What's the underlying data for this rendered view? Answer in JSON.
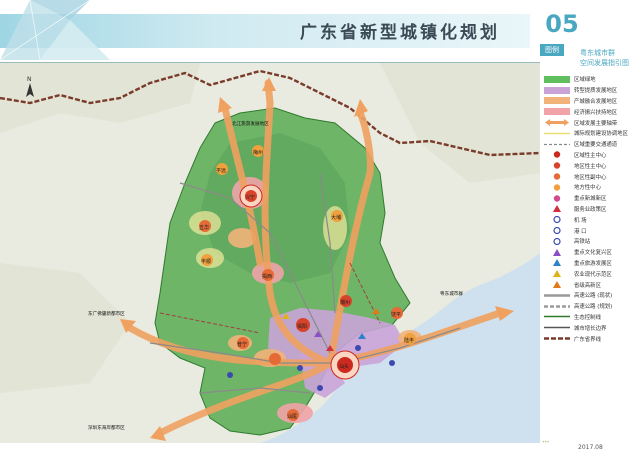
{
  "header": {
    "title": "广东省新型城镇化规划",
    "chapter": "05"
  },
  "side": {
    "legend_tag": "图例",
    "title_line1": "粤东城市群",
    "title_line2": "空间发展指引图",
    "date": "2017.08",
    "logo": "ᐩᐩᐩ"
  },
  "legend": [
    {
      "label": "区域绿地",
      "swatch": "fill",
      "color": "#5fbf5f"
    },
    {
      "label": "转型提质发展地区",
      "swatch": "fill",
      "color": "#c9a3d8"
    },
    {
      "label": "产城融合发展地区",
      "swatch": "fill",
      "color": "#f2b37a"
    },
    {
      "label": "经济振兴扶持地区",
      "swatch": "fill",
      "color": "#f1a3a8"
    },
    {
      "label": "区域发展主要轴带",
      "swatch": "arrow",
      "color": "#f0a160"
    },
    {
      "label": "城际规划建设协调地区",
      "swatch": "line",
      "color": "#e8e070"
    },
    {
      "label": "区域重要交通通道",
      "swatch": "dash",
      "color": "#888888"
    },
    {
      "label": "区域性主中心",
      "swatch": "circle",
      "color": "#cc2a1f"
    },
    {
      "label": "地区性主中心",
      "swatch": "circle",
      "color": "#d8432b"
    },
    {
      "label": "地区性副中心",
      "swatch": "circle",
      "color": "#e56a36"
    },
    {
      "label": "地方性中心",
      "swatch": "circle",
      "color": "#f0a03c"
    },
    {
      "label": "重点新城新区",
      "swatch": "circle",
      "color": "#d24b8f"
    },
    {
      "label": "服务业政策区",
      "swatch": "tri",
      "color": "#d02f3e"
    },
    {
      "label": "机  场",
      "swatch": "icon",
      "color": "#3b4ab0"
    },
    {
      "label": "港  口",
      "swatch": "icon",
      "color": "#3b4ab0"
    },
    {
      "label": "高铁站",
      "swatch": "icon",
      "color": "#3b4ab0"
    },
    {
      "label": "重点文化复兴区",
      "swatch": "tri",
      "color": "#8a4fc4"
    },
    {
      "label": "重点旅游发展区",
      "swatch": "tri",
      "color": "#2c83c9"
    },
    {
      "label": "农业现代示范区",
      "swatch": "tri",
      "color": "#e0b21a"
    },
    {
      "label": "省级高新区",
      "swatch": "tri",
      "color": "#e07a1a"
    },
    {
      "label": "高速公路 (现状)",
      "swatch": "road",
      "color": "#9a9a9a"
    },
    {
      "label": "高速公路 (规划)",
      "swatch": "road2",
      "color": "#9a9a9a"
    },
    {
      "label": "生态控制线",
      "swatch": "line",
      "color": "#2f7a2f"
    },
    {
      "label": "城市增长边界",
      "swatch": "line",
      "color": "#555555"
    },
    {
      "label": "广东省界线",
      "swatch": "border",
      "color": "#7a3b2a"
    }
  ],
  "map": {
    "corridor_labels": [
      {
        "text": "北江旅游发展地区"
      },
      {
        "text": "东广佛肇新都市区"
      },
      {
        "text": "深圳东海岸都市区"
      },
      {
        "text": "粤东城市群"
      }
    ],
    "cities": [
      {
        "name": "兴宁"
      },
      {
        "name": "梅州"
      },
      {
        "name": "平远"
      },
      {
        "name": "五华"
      },
      {
        "name": "丰顺"
      },
      {
        "name": "大埔"
      },
      {
        "name": "揭西"
      },
      {
        "name": "普宁"
      },
      {
        "name": "揭阳"
      },
      {
        "name": "潮州"
      },
      {
        "name": "汕头"
      },
      {
        "name": "饶平"
      },
      {
        "name": "汕尾"
      },
      {
        "name": "陆丰"
      }
    ]
  }
}
